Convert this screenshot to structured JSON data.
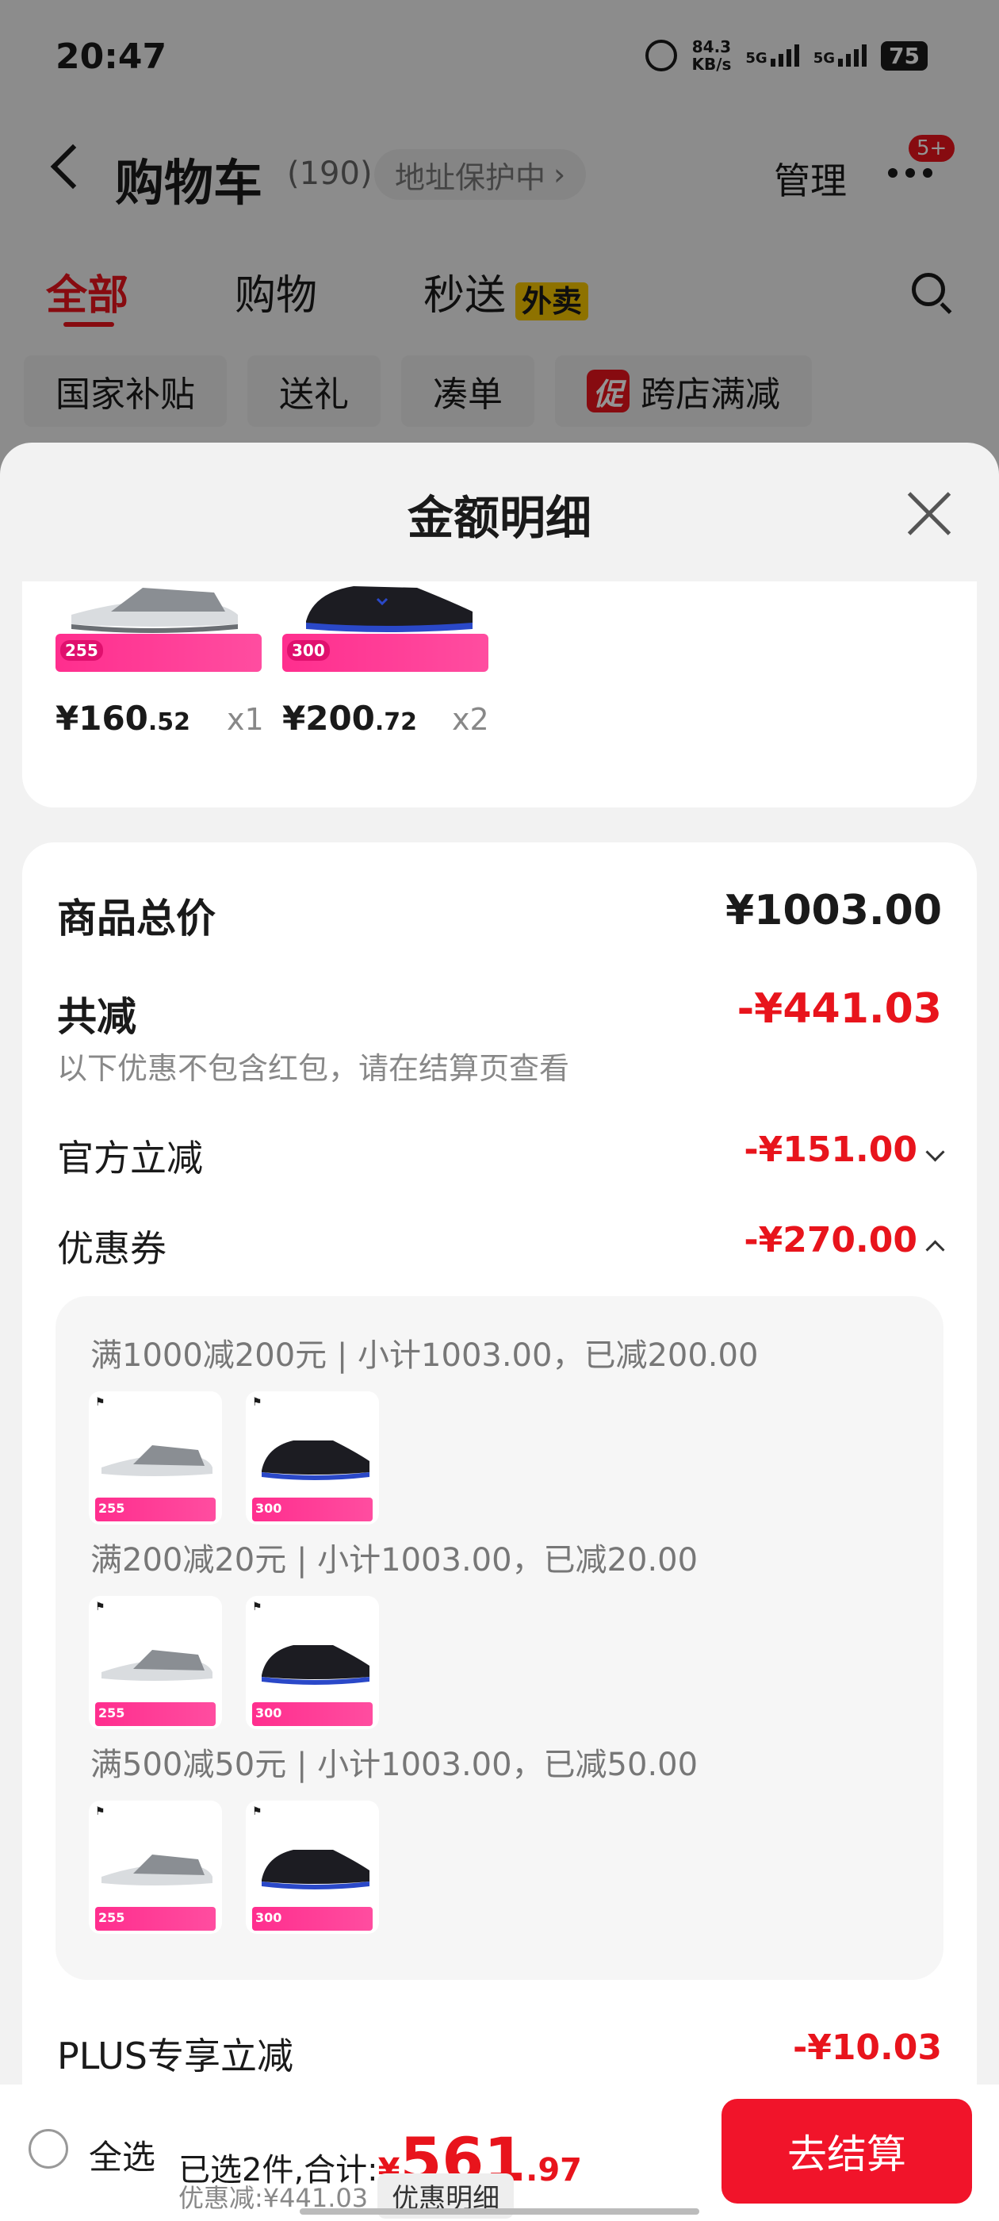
{
  "status_bar": {
    "time": "20:47",
    "net_speed": "84.3",
    "net_unit": "KB/s",
    "sig1": "5G",
    "sig2": "5G",
    "battery": "75"
  },
  "nav": {
    "title": "购物车",
    "count": "(190)",
    "address_pill": "地址保护中",
    "manage": "管理",
    "badge": "5+"
  },
  "tabs": {
    "all": "全部",
    "shopping": "购物",
    "flash": "秒送",
    "waimai": "外卖"
  },
  "chips": [
    "国家补贴",
    "送礼",
    "凑单",
    "跨店满减"
  ],
  "promo_icon": "促",
  "sheet": {
    "title": "金额明细",
    "products": [
      {
        "price_int": "¥160",
        "price_dec": ".52",
        "qty": "x1",
        "promo": "255"
      },
      {
        "price_int": "¥200",
        "price_dec": ".72",
        "qty": "x2",
        "promo": "300"
      }
    ],
    "total_label": "商品总价",
    "total_value": "¥1003.00",
    "reduce_label": "共减",
    "reduce_value": "-¥441.03",
    "reduce_note": "以下优惠不包含红包，请在结算页查看",
    "official_label": "官方立减",
    "official_value": "-¥151.00",
    "coupon_label": "优惠券",
    "coupon_value": "-¥270.00",
    "coupon_lines": [
      "满1000减200元 | 小计1003.00，已减200.00",
      "满200减20元 | 小计1003.00，已减20.00",
      "满500减50元 | 小计1003.00，已减50.00"
    ],
    "thumb_promos": [
      "255",
      "300"
    ],
    "plus_label": "PLUS专享立减",
    "plus_value": "-¥10.03"
  },
  "bottom": {
    "select_all": "全选",
    "summary_prefix": "已选2件,合计:",
    "total_symbol": "¥",
    "total_int": "561",
    "total_dec": ".97",
    "discount_text": "优惠减:¥441.03",
    "detail_button": "优惠明细",
    "checkout": "去结算"
  }
}
